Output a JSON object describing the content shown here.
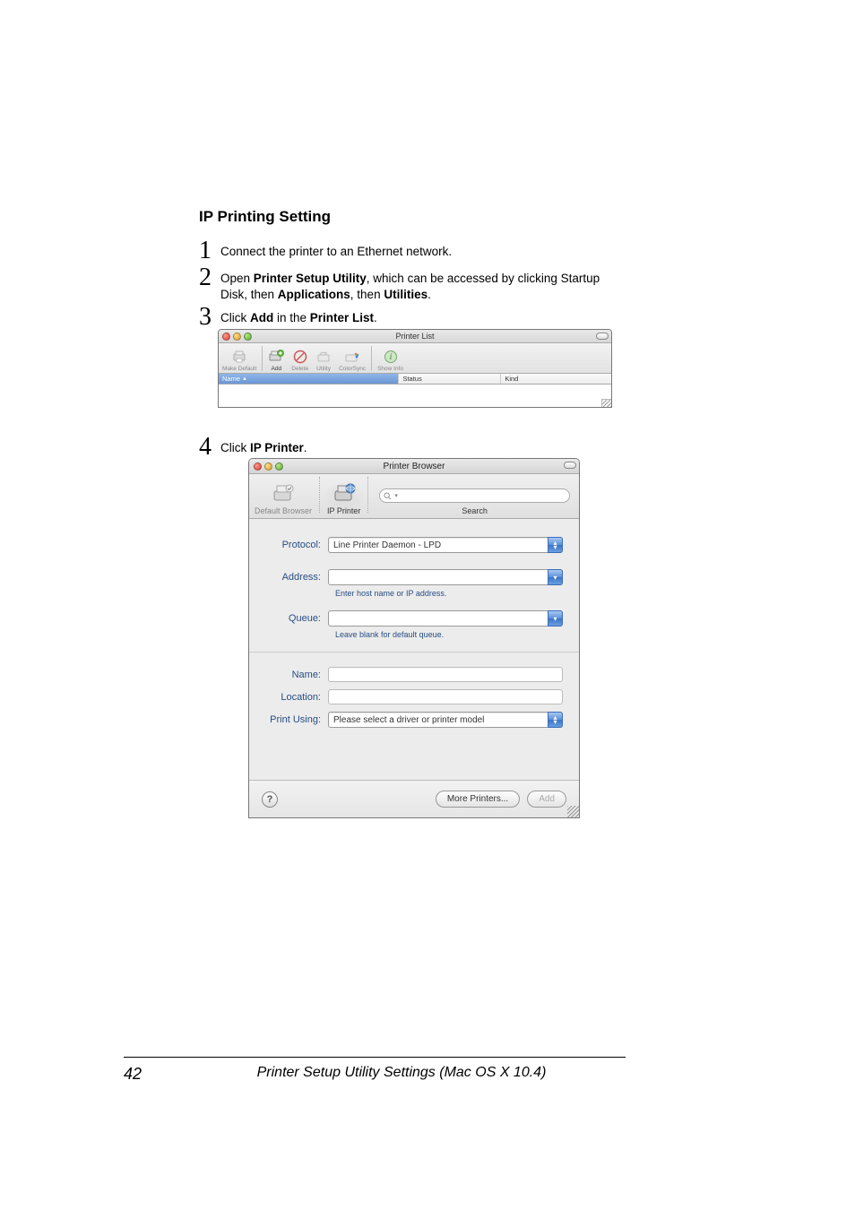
{
  "heading": "IP Printing Setting",
  "steps": {
    "s1": {
      "num": "1",
      "text": "Connect the printer to an Ethernet network."
    },
    "s2": {
      "num": "2",
      "pre": "Open ",
      "b1": "Printer Setup Utility",
      "mid1": ", which can be accessed by clicking Startup Disk, then ",
      "b2": "Applications",
      "mid2": ", then ",
      "b3": "Utilities",
      "post": "."
    },
    "s3": {
      "num": "3",
      "pre": "Click ",
      "b1": "Add",
      "mid": " in the ",
      "b2": "Printer List",
      "post": "."
    },
    "s4": {
      "num": "4",
      "pre": "Click ",
      "b1": "IP Printer",
      "post": "."
    }
  },
  "printer_list_window": {
    "title": "Printer List",
    "toolbar": {
      "make_default": "Make Default",
      "add": "Add",
      "delete": "Delete",
      "utility": "Utility",
      "colorsync": "ColorSync",
      "show_info": "Show Info"
    },
    "columns": {
      "name": "Name",
      "status": "Status",
      "kind": "Kind"
    }
  },
  "printer_browser_window": {
    "title": "Printer Browser",
    "toolbar": {
      "default_browser": "Default Browser",
      "ip_printer": "IP Printer",
      "search": "Search",
      "search_placeholder": ""
    },
    "form": {
      "protocol_label": "Protocol:",
      "protocol_value": "Line Printer Daemon - LPD",
      "address_label": "Address:",
      "address_value": "",
      "address_hint": "Enter host name or IP address.",
      "queue_label": "Queue:",
      "queue_value": "",
      "queue_hint": "Leave blank for default queue.",
      "name_label": "Name:",
      "name_value": "",
      "location_label": "Location:",
      "location_value": "",
      "print_using_label": "Print Using:",
      "print_using_value": "Please select a driver or printer model"
    },
    "buttons": {
      "help": "?",
      "more_printers": "More Printers...",
      "add": "Add"
    }
  },
  "footer": {
    "page": "42",
    "text": "Printer Setup Utility Settings (Mac OS X 10.4)"
  }
}
